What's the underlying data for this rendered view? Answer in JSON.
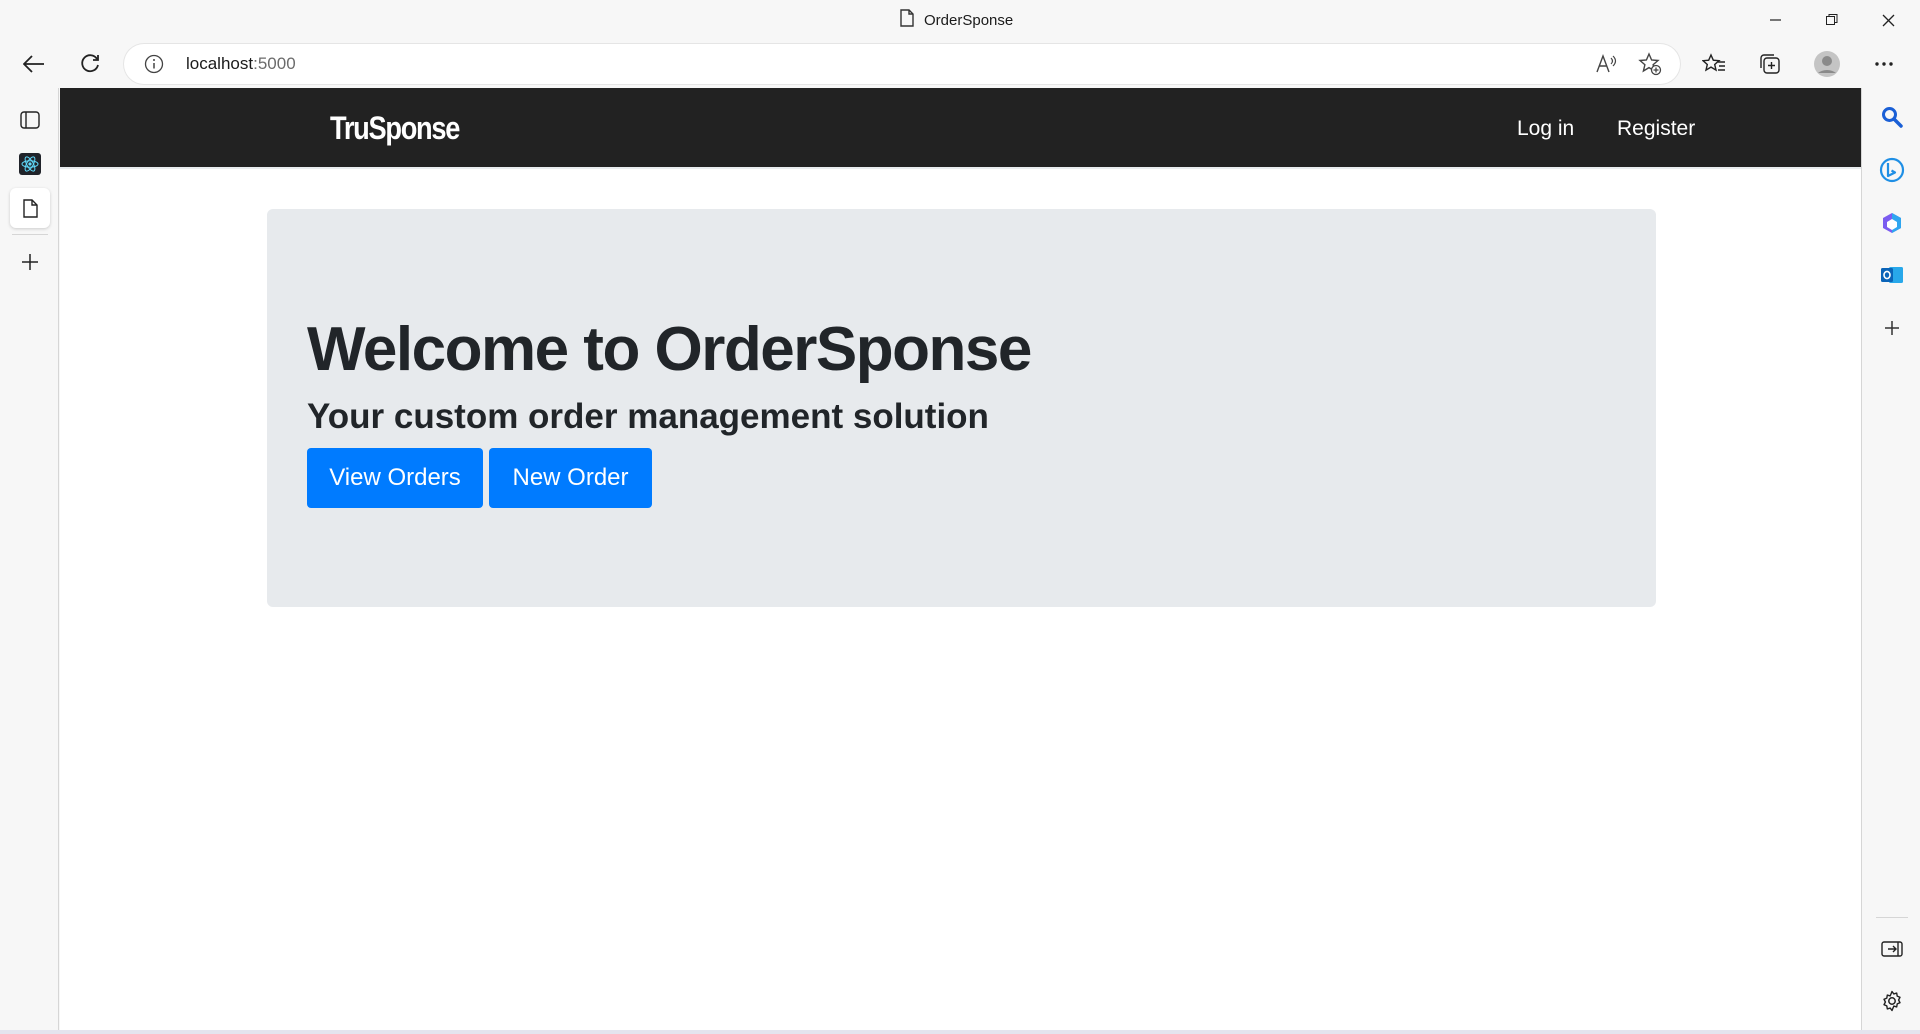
{
  "browser": {
    "tab_title": "OrderSponse",
    "address_host": "localhost",
    "address_port": ":5000",
    "icons": {
      "back": "back-arrow-icon",
      "refresh": "refresh-icon",
      "info": "info-icon",
      "read_aloud": "read-aloud-icon",
      "add_favorite": "add-favorite-icon",
      "favorites": "favorites-icon",
      "collections": "collections-icon",
      "profile": "profile-icon",
      "more": "more-icon"
    }
  },
  "navbar": {
    "brand": "TruSponse",
    "login_label": "Log in",
    "register_label": "Register",
    "background": "#222222"
  },
  "hero": {
    "title": "Welcome to OrderSponse",
    "subtitle": "Your custom order management solution",
    "view_orders_label": "View Orders",
    "new_order_label": "New Order",
    "button_color": "#007bff",
    "panel_color": "#e7eaed"
  }
}
